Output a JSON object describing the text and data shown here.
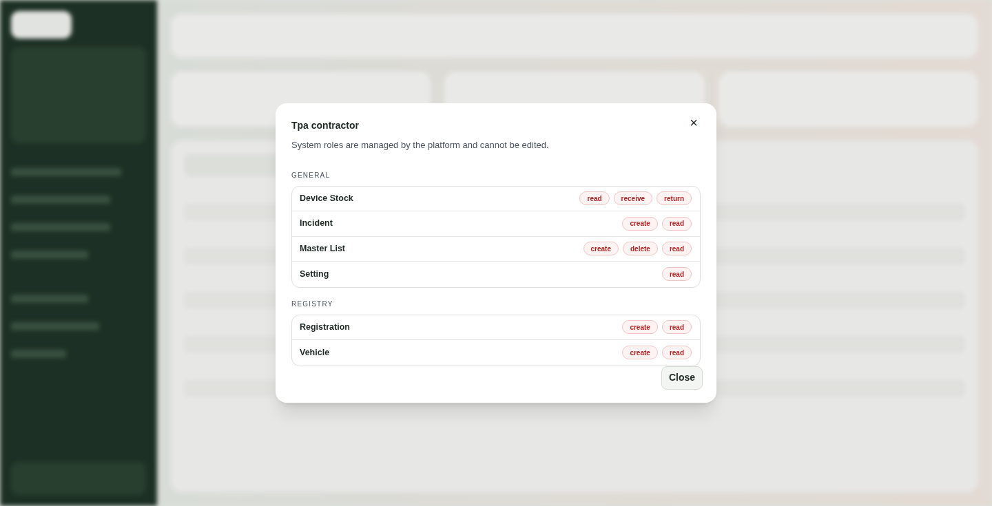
{
  "dialog": {
    "title": "Tpa contractor",
    "subtitle": "System roles are managed by the platform and cannot be edited.",
    "close_icon": "×",
    "sections": [
      {
        "heading": "GENERAL",
        "rows": [
          {
            "name": "Device Stock",
            "permissions": [
              "read",
              "receive",
              "return"
            ]
          },
          {
            "name": "Incident",
            "permissions": [
              "create",
              "read"
            ]
          },
          {
            "name": "Master List",
            "permissions": [
              "create",
              "delete",
              "read"
            ]
          },
          {
            "name": "Setting",
            "permissions": [
              "read"
            ]
          }
        ]
      },
      {
        "heading": "REGISTRY",
        "rows": [
          {
            "name": "Registration",
            "permissions": [
              "create",
              "read"
            ]
          },
          {
            "name": "Vehicle",
            "permissions": [
              "create",
              "read"
            ]
          }
        ]
      }
    ],
    "close_button": "Close"
  }
}
